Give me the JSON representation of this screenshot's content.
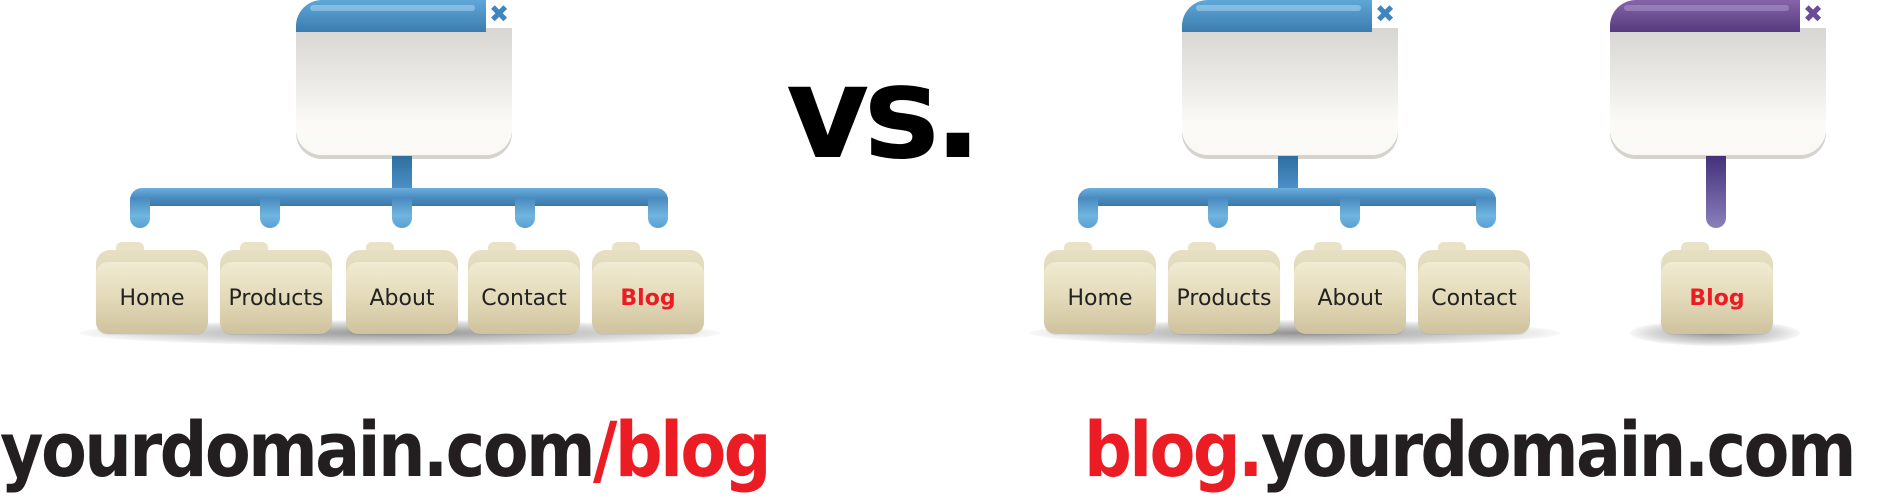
{
  "colors": {
    "accent_red": "#ec1c24",
    "text_dark": "#231f20",
    "connector_blue": "#4a8bbf",
    "connector_purple": "#56397f",
    "folder_tan": "#e3dab9"
  },
  "left_diagram": {
    "window_icon": "browser-window-icon",
    "close_icon": "✖",
    "folders": [
      {
        "label": "Home",
        "highlight": false
      },
      {
        "label": "Products",
        "highlight": false
      },
      {
        "label": "About",
        "highlight": false
      },
      {
        "label": "Contact",
        "highlight": false
      },
      {
        "label": "Blog",
        "highlight": true
      }
    ],
    "url": {
      "main": "yourdomain.com",
      "suffix": "/blog"
    }
  },
  "separator": {
    "label": "vs."
  },
  "right_diagram": {
    "main_site": {
      "close_icon": "✖",
      "folders": [
        {
          "label": "Home"
        },
        {
          "label": "Products"
        },
        {
          "label": "About"
        },
        {
          "label": "Contact"
        }
      ]
    },
    "blog_site": {
      "close_icon": "✖",
      "folders": [
        {
          "label": "Blog",
          "highlight": true
        }
      ]
    },
    "url": {
      "prefix": "blog.",
      "main": "yourdomain.com"
    }
  }
}
